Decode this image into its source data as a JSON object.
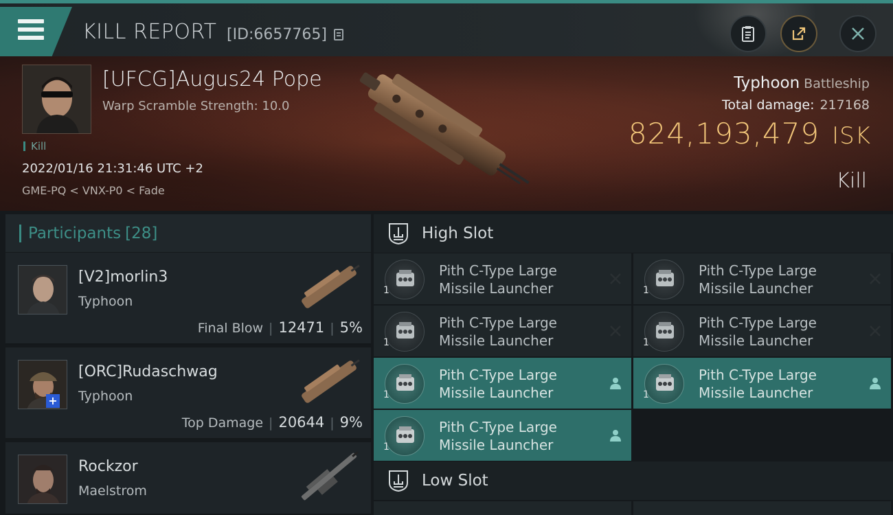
{
  "header": {
    "title": "KILL REPORT",
    "report_id": "[ID:6657765]",
    "buttons": [
      "clipboard",
      "share",
      "close"
    ]
  },
  "victim": {
    "name": "[UFCG]Augus24 Pope",
    "subtitle": "Warp Scramble Strength: 10.0",
    "tag": "Kill",
    "datetime": "2022/01/16 21:31:46 UTC +2",
    "route": "GME-PQ < VNX-P0 < Fade",
    "ship_name": "Typhoon",
    "ship_class": "Battleship",
    "total_damage_label": "Total damage:",
    "total_damage": "217168",
    "isk_value": "824,193,479",
    "isk_unit": "ISK",
    "result": "Kill"
  },
  "participants": {
    "label": "Participants",
    "count": "[28]",
    "items": [
      {
        "name": "[V2]morlin3",
        "ship": "Typhoon",
        "role": "Final Blow",
        "damage": "12471",
        "percent": "5%"
      },
      {
        "name": "[ORC]Rudaschwag",
        "ship": "Typhoon",
        "role": "Top Damage",
        "damage": "20644",
        "percent": "9%"
      },
      {
        "name": "Rockzor",
        "ship": "Maelstrom"
      }
    ]
  },
  "slots": {
    "high_label": "High Slot",
    "low_label": "Low Slot",
    "high": [
      {
        "line1": "Pith C-Type Large",
        "line2": "Missile Launcher",
        "qty": "1",
        "status": "destroyed"
      },
      {
        "line1": "Pith C-Type Large",
        "line2": "Missile Launcher",
        "qty": "1",
        "status": "destroyed"
      },
      {
        "line1": "Pith C-Type Large",
        "line2": "Missile Launcher",
        "qty": "1",
        "status": "destroyed"
      },
      {
        "line1": "Pith C-Type Large",
        "line2": "Missile Launcher",
        "qty": "1",
        "status": "destroyed"
      },
      {
        "line1": "Pith C-Type Large",
        "line2": "Missile Launcher",
        "qty": "1",
        "status": "dropped"
      },
      {
        "line1": "Pith C-Type Large",
        "line2": "Missile Launcher",
        "qty": "1",
        "status": "dropped"
      },
      {
        "line1": "Pith C-Type Large",
        "line2": "Missile Launcher",
        "qty": "1",
        "status": "dropped"
      }
    ]
  },
  "colors": {
    "accent": "#3a8b83",
    "isk": "#f3c77a",
    "fitted_row": "#2e6f6a"
  }
}
